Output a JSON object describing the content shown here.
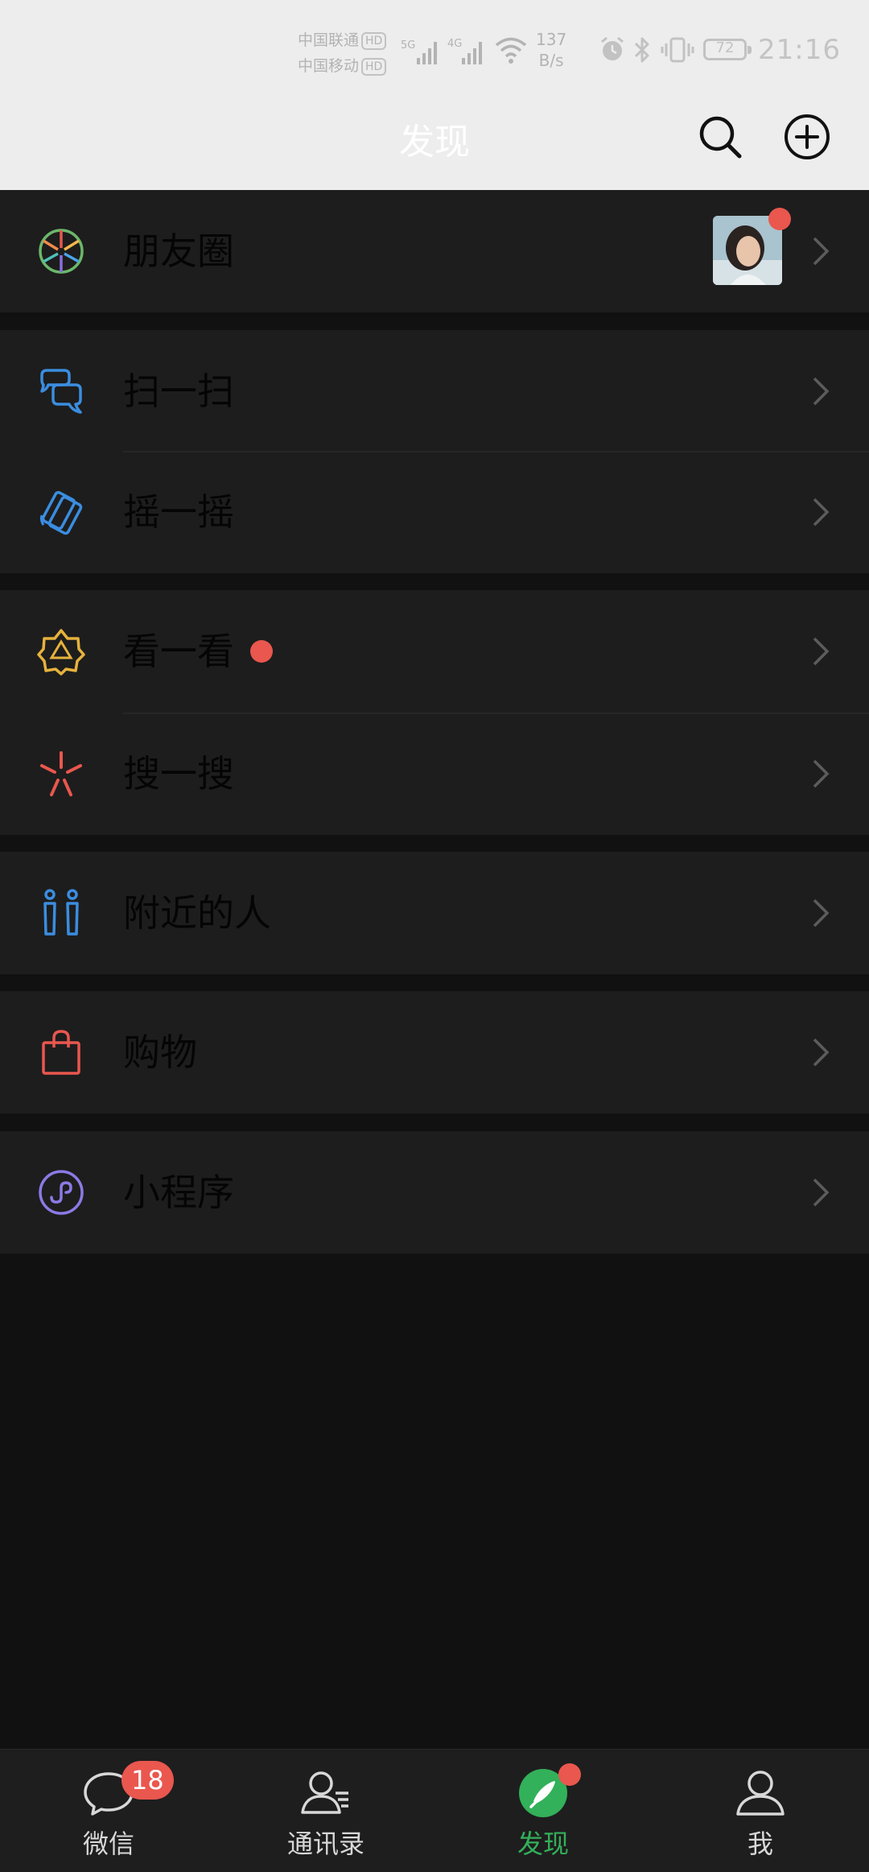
{
  "status_bar": {
    "carrier1": "中国联通",
    "carrier2": "中国移动",
    "hd_label": "HD",
    "net1": "5G",
    "net2": "4G",
    "speed_value": "137",
    "speed_unit": "B/s",
    "battery": "72",
    "time": "21:16"
  },
  "header": {
    "title": "发现",
    "search_icon": "search-icon",
    "add_icon": "plus-circle-icon"
  },
  "menu": [
    {
      "label": "朋友圈",
      "icon": "moments-aperture-icon",
      "has_thumbnail": true,
      "red_dot": true
    },
    {
      "label": "扫一扫",
      "icon": "scan-icon"
    },
    {
      "label": "摇一摇",
      "icon": "shake-icon"
    },
    {
      "label": "看一看",
      "icon": "top-stories-icon",
      "red_dot": true
    },
    {
      "label": "搜一搜",
      "icon": "search-spark-icon"
    },
    {
      "label": "附近的人",
      "icon": "people-nearby-icon"
    },
    {
      "label": "购物",
      "icon": "shopping-bag-icon"
    },
    {
      "label": "小程序",
      "icon": "mini-program-icon"
    }
  ],
  "tabs": [
    {
      "label": "微信",
      "icon": "chat-bubble-icon",
      "badge": "18"
    },
    {
      "label": "通讯录",
      "icon": "contacts-icon"
    },
    {
      "label": "发现",
      "icon": "compass-icon",
      "active": true,
      "red_dot": true
    },
    {
      "label": "我",
      "icon": "person-icon"
    }
  ],
  "colors": {
    "accent_green": "#33b05a",
    "badge_red": "#e9574e",
    "row_bg": "#1d1d1d",
    "page_bg": "#111111",
    "header_bg": "#ededed"
  }
}
